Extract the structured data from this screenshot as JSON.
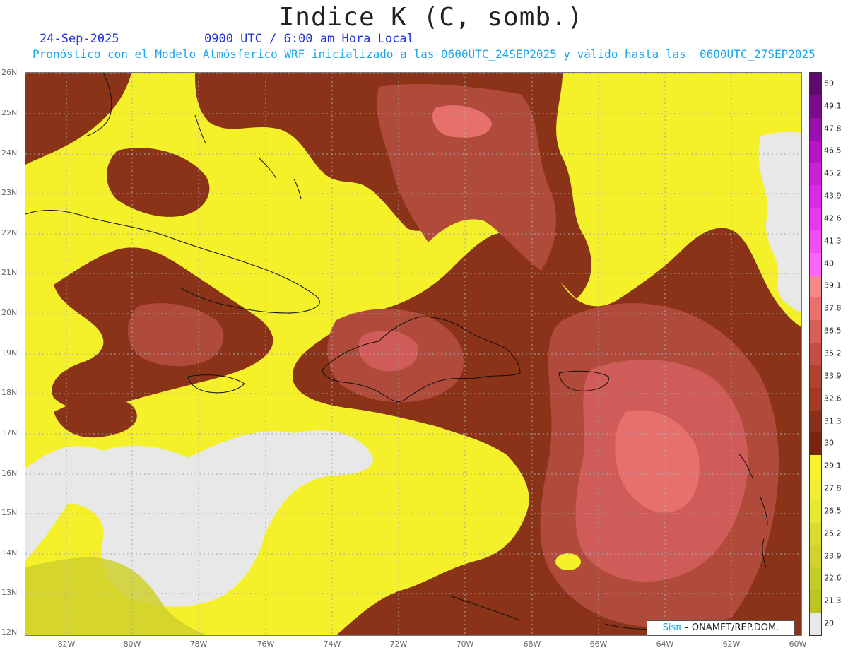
{
  "title": "Indice K (C, somb.)",
  "date": "24-Sep-2025",
  "time_text": "0900 UTC / 6:00 am Hora Local",
  "forecast_text": "Pronóstico con el Modelo Atmósferico WRF inicializado a las 0600UTC_24SEP2025 y válido hasta las  0600UTC_27SEP2025",
  "credit": {
    "brand": "Sisπ",
    "text": "– ONAMET/REP.DOM."
  },
  "lat_labels": [
    "26N",
    "25N",
    "24N",
    "23N",
    "22N",
    "21N",
    "20N",
    "19N",
    "18N",
    "17N",
    "16N",
    "15N",
    "14N",
    "13N",
    "12N"
  ],
  "lon_labels": [
    "82W",
    "80W",
    "78W",
    "76W",
    "74W",
    "72W",
    "70W",
    "68W",
    "66W",
    "64W",
    "62W",
    "60W"
  ],
  "colorbar": {
    "labels": [
      "50",
      "49.1",
      "47.8",
      "46.5",
      "45.2",
      "43.9",
      "42.6",
      "41.3",
      "40",
      "39.1",
      "37.8",
      "36.5",
      "35.2",
      "33.9",
      "32.6",
      "31.3",
      "30",
      "29.1",
      "27.8",
      "26.5",
      "25.2",
      "23.9",
      "22.6",
      "21.3",
      "20"
    ],
    "colors": [
      "#5c0a6b",
      "#7a0c8a",
      "#9a10aa",
      "#b515c4",
      "#cc1fd8",
      "#dd28e6",
      "#ea36ee",
      "#f24ef5",
      "#ff66ff",
      "#f7878a",
      "#e9706c",
      "#d85f58",
      "#c44e44",
      "#b0432f",
      "#a23a26",
      "#8a2f18",
      "#7a260f",
      "#f7f22b",
      "#f0ef30",
      "#e6e832",
      "#d9dd30",
      "#cfd42d",
      "#c4cc28",
      "#bcc424",
      "#e8e8e8"
    ]
  },
  "colors": {
    "low": "#e8e8e8",
    "yellow": "#f4f12a",
    "olive": "#c9cb2a",
    "brown": "#8a3318",
    "rust": "#b04a3a",
    "salmon": "#cf5c58",
    "pink": "#e8706c"
  }
}
